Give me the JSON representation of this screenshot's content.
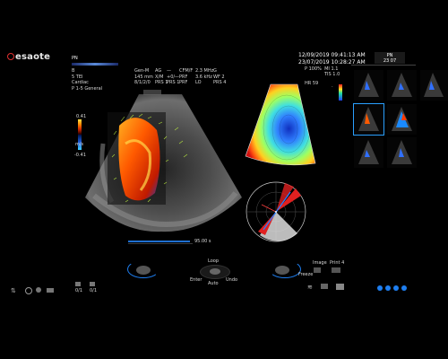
{
  "brand": {
    "logo_text": "esaote"
  },
  "patient": {
    "tab": "PN"
  },
  "header": {
    "mode_label": "PN",
    "col1": [
      "B",
      "5 TEI",
      "Cardiac",
      "P 1-5 General"
    ],
    "col2": [
      "Gen-M",
      "145 mm",
      "8/1/2/0"
    ],
    "col3": [
      "AG",
      "X/M",
      "PRS 1"
    ],
    "col4": [
      "—",
      "+0/—",
      "PRS 1"
    ],
    "col5": [
      "CFM/F",
      "PRF",
      "PRF"
    ],
    "col6": [
      "2.3 MHz",
      "3.6 kHz",
      "LO"
    ],
    "col7": [
      "G",
      "WF 2",
      "PRS 4"
    ]
  },
  "datetime": {
    "line1": "12/09/2019 09:41:13 AM",
    "line2": "23/07/2019 10:28:27 AM",
    "params": [
      "P",
      "100%",
      "MI",
      "1.1",
      "TIS",
      "1.0"
    ]
  },
  "tab_bar": {
    "id_label": "PN",
    "frame_label": "23 07"
  },
  "hr_label": "HR 59",
  "color_scale": {
    "top": "0.41",
    "unit": "m/s",
    "bottom": "-0.41"
  },
  "playback": {
    "time_label": "95.00 s",
    "progress": 0.96
  },
  "bottom": {
    "loop_label": "Loop",
    "enter_label": "Enter",
    "auto_label": "Auto",
    "undo_label": "Undo",
    "freeze_label": "Freeze",
    "image_label": "Image",
    "print_label": "Print 4",
    "counter1": "0/1",
    "counter2": "0/1"
  },
  "colors": {
    "accent": "#1e7ef0",
    "brand_red": "#e03030",
    "selection": "#2aa0ff"
  }
}
